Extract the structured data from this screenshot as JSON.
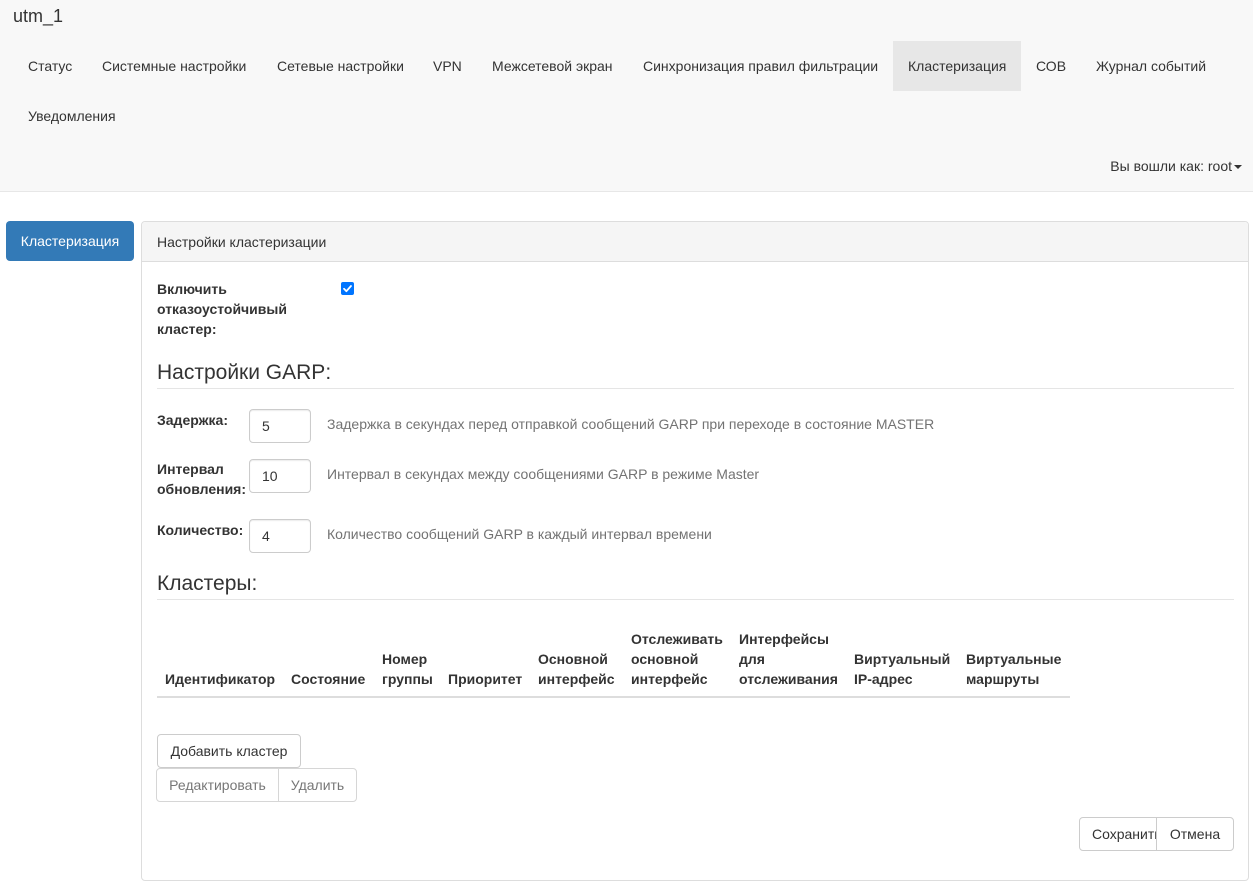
{
  "brand": "utm_1",
  "nav": {
    "items": [
      "Статус",
      "Системные настройки",
      "Сетевые настройки",
      "VPN",
      "Межсетевой экран",
      "Синхронизация правил фильтрации",
      "Кластеризация",
      "СОВ",
      "Журнал событий",
      "Уведомления"
    ],
    "active": "Кластеризация",
    "user": "Вы вошли как: root"
  },
  "side_tab": "Кластеризация",
  "panel": {
    "heading": "Настройки кластеризации",
    "enable": {
      "label_lines": [
        "Включить",
        "отказоустойчивый",
        "кластер:"
      ],
      "checked": true
    },
    "garp": {
      "title": "Настройки GARP:",
      "delay": {
        "label_lines": [
          "Задержка:"
        ],
        "value": "5",
        "help": "Задержка в секундах перед отправкой сообщений GARP при переходе в состояние MASTER"
      },
      "interval": {
        "label_lines": [
          "Интервал",
          "обновления:"
        ],
        "value": "10",
        "help": "Интервал в секундах между сообщениями GARP в режиме Master"
      },
      "count": {
        "label_lines": [
          "Количество:"
        ],
        "value": "4",
        "help": "Количество сообщений GARP в каждый интервал времени"
      }
    },
    "clusters": {
      "title": "Кластеры:",
      "columns": [
        [
          "Идентификатор"
        ],
        [
          "Состояние"
        ],
        [
          "Номер",
          "группы"
        ],
        [
          "Приоритет"
        ],
        [
          "Основной",
          "интерфейс"
        ],
        [
          "Отслеживать",
          "основной",
          "интерфейс"
        ],
        [
          "Интерфейсы",
          "для",
          "отслеживания"
        ],
        [
          "Виртуальный",
          "IP-адрес"
        ],
        [
          "Виртуальные",
          "маршруты"
        ]
      ],
      "rows": []
    },
    "buttons": {
      "add": "Добавить кластер",
      "edit": "Редактировать",
      "delete": "Удалить",
      "save": "Сохранить",
      "cancel": "Отмена"
    }
  },
  "colors": {
    "accent": "#337ab7",
    "nav_bg": "#f8f8f8",
    "nav_active_bg": "#e7e7e7",
    "checkbox": "#0075ff"
  }
}
